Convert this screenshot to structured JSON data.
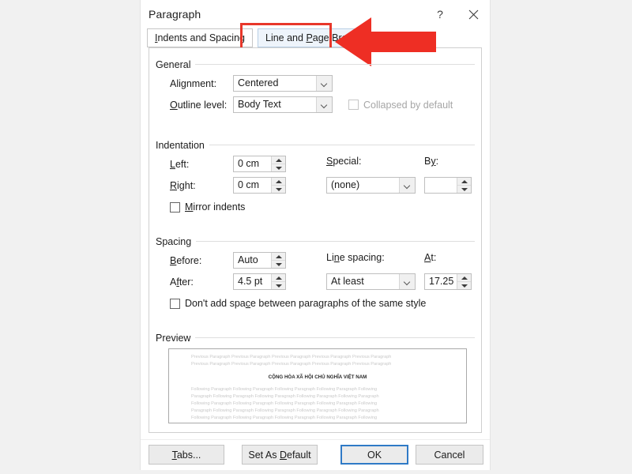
{
  "window": {
    "title": "Paragraph",
    "help_icon": "question-mark-icon",
    "close_icon": "close-icon"
  },
  "tabs": [
    {
      "label": "Indents and Spacing",
      "selected": false,
      "accesskey": "I"
    },
    {
      "label": "Line and Page Breaks",
      "selected": true,
      "accesskey": "P"
    }
  ],
  "annotation": {
    "arrow_color": "#e8372a",
    "highlight_color": "#e8372a",
    "arrow_direction": "left",
    "target": "Line and Page Breaks"
  },
  "general": {
    "title": "General",
    "alignment": {
      "label": "Alignment:",
      "value": "Centered"
    },
    "outline_level": {
      "label": "Outline level:",
      "value": "Body Text"
    },
    "collapsed_by_default": {
      "label": "Collapsed by default",
      "checked": false,
      "enabled": false
    }
  },
  "indentation": {
    "title": "Indentation",
    "left": {
      "label": "Left:",
      "value": "0 cm"
    },
    "right": {
      "label": "Right:",
      "value": "0 cm"
    },
    "special": {
      "label": "Special:",
      "value": "(none)"
    },
    "by": {
      "label": "By:",
      "value": ""
    },
    "mirror_indents": {
      "label": "Mirror indents",
      "checked": false
    }
  },
  "spacing": {
    "title": "Spacing",
    "before": {
      "label": "Before:",
      "value": "Auto"
    },
    "after": {
      "label": "After:",
      "value": "4.5 pt"
    },
    "line_spacing": {
      "label": "Line spacing:",
      "value": "At least"
    },
    "at": {
      "label": "At:",
      "value": "17.25 pt"
    },
    "dont_add_space": {
      "label": "Don't add space between paragraphs of the same style",
      "checked": false
    }
  },
  "preview": {
    "title": "Preview",
    "previous_lines": [
      "Previous Paragraph Previous Paragraph Previous Paragraph Previous Paragraph Previous Paragraph",
      "Previous Paragraph Previous Paragraph Previous Paragraph Previous Paragraph Previous Paragraph"
    ],
    "sample_text": "CỘNG HÒA XÃ HỘI CHỦ NGHĨA VIỆT NAM",
    "following_lines": [
      "Following Paragraph Following Paragraph Following Paragraph Following Paragraph Following",
      "Paragraph Following Paragraph Following Paragraph Following Paragraph Following Paragraph",
      "Following Paragraph Following Paragraph Following Paragraph Following Paragraph Following",
      "Paragraph Following Paragraph Following Paragraph Following Paragraph Following Paragraph",
      "Following Paragraph Following Paragraph Following Paragraph Following Paragraph Following"
    ]
  },
  "footer": {
    "tabs_button": "Tabs...",
    "set_as_default_button": "Set As Default",
    "ok_button": "OK",
    "cancel_button": "Cancel"
  }
}
